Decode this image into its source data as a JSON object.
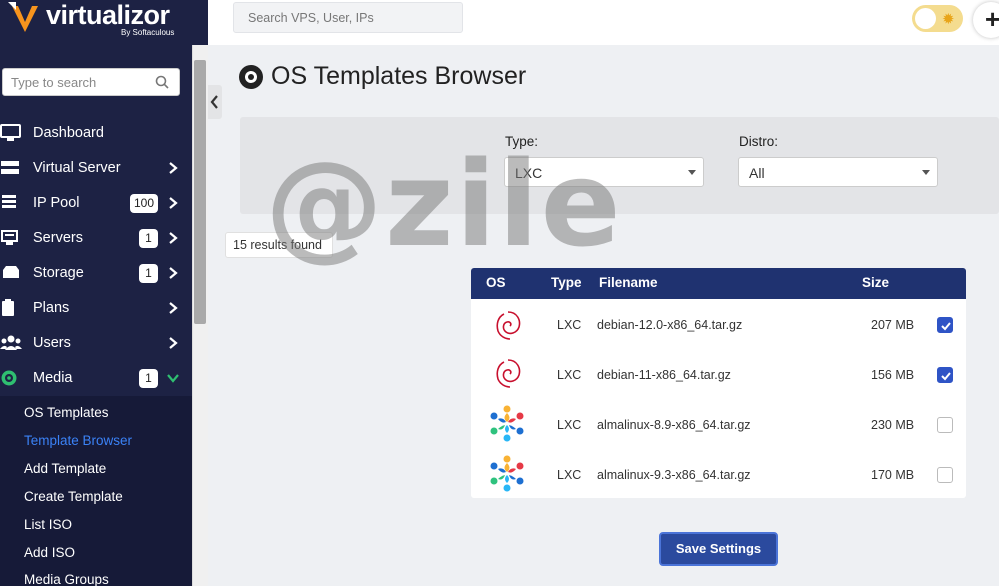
{
  "brand": {
    "name": "virtualizor",
    "sub": "By Softaculous"
  },
  "sidebar": {
    "search_placeholder": "Type to search",
    "items": [
      {
        "label": "Dashboard",
        "icon": "monitor-icon"
      },
      {
        "label": "Virtual Server",
        "icon": "server-icon"
      },
      {
        "label": "IP Pool",
        "icon": "ip-pool-icon",
        "badge": "100"
      },
      {
        "label": "Servers",
        "icon": "servers-icon",
        "badge": "1"
      },
      {
        "label": "Storage",
        "icon": "storage-icon",
        "badge": "1"
      },
      {
        "label": "Plans",
        "icon": "clipboard-icon"
      },
      {
        "label": "Users",
        "icon": "users-icon"
      },
      {
        "label": "Media",
        "icon": "media-disc-icon",
        "badge": "1"
      }
    ],
    "submenu": [
      {
        "label": "OS Templates"
      },
      {
        "label": "Template Browser",
        "active": true
      },
      {
        "label": "Add Template"
      },
      {
        "label": "Create Template"
      },
      {
        "label": "List ISO"
      },
      {
        "label": "Add ISO"
      },
      {
        "label": "Media Groups"
      }
    ]
  },
  "topbar": {
    "search_placeholder": "Search VPS, User, IPs"
  },
  "page": {
    "title": "OS Templates Browser",
    "type_label": "Type:",
    "type_value": "LXC",
    "distro_label": "Distro:",
    "distro_value": "All",
    "results": "15 results found",
    "watermark": "@zile"
  },
  "table": {
    "headers": {
      "os": "OS",
      "type": "Type",
      "filename": "Filename",
      "size": "Size"
    },
    "rows": [
      {
        "os": "debian",
        "type": "LXC",
        "filename": "debian-12.0-x86_64.tar.gz",
        "size": "207 MB",
        "checked": true
      },
      {
        "os": "debian",
        "type": "LXC",
        "filename": "debian-11-x86_64.tar.gz",
        "size": "156 MB",
        "checked": true
      },
      {
        "os": "almalinux",
        "type": "LXC",
        "filename": "almalinux-8.9-x86_64.tar.gz",
        "size": "230 MB",
        "checked": false
      },
      {
        "os": "almalinux",
        "type": "LXC",
        "filename": "almalinux-9.3-x86_64.tar.gz",
        "size": "170 MB",
        "checked": false
      }
    ]
  },
  "save_button": "Save Settings",
  "colors": {
    "sidebar": "#1d2244",
    "accent": "#2b4a9e",
    "table_header": "#1f3270",
    "active_link": "#3b82f6"
  }
}
